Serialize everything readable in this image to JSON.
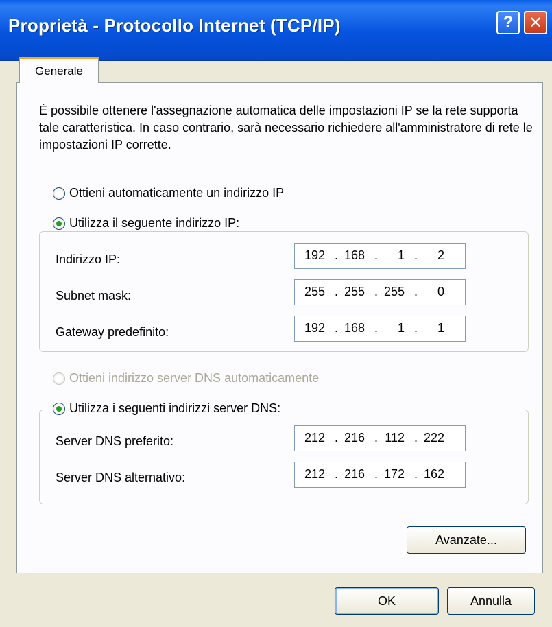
{
  "window": {
    "title": "Proprietà - Protocollo Internet (TCP/IP)",
    "help_label": "?",
    "close_label": "✕"
  },
  "tab": {
    "label": "Generale"
  },
  "description": "È possibile ottenere l'assegnazione automatica delle impostazioni IP se la rete supporta tale caratteristica. In caso contrario, sarà necessario richiedere all'amministratore di rete le impostazioni IP corrette.",
  "ip": {
    "auto_label": "Ottieni automaticamente un indirizzo IP",
    "auto_selected": false,
    "manual_label": "Utilizza il seguente indirizzo IP:",
    "manual_selected": true,
    "fields": [
      {
        "label": "Indirizzo IP:",
        "octets": [
          "192",
          "168",
          "1",
          "2"
        ]
      },
      {
        "label": "Subnet mask:",
        "octets": [
          "255",
          "255",
          "255",
          "0"
        ]
      },
      {
        "label": "Gateway predefinito:",
        "octets": [
          "192",
          "168",
          "1",
          "1"
        ]
      }
    ]
  },
  "dns": {
    "auto_label": "Ottieni indirizzo server DNS automaticamente",
    "auto_enabled": false,
    "manual_label": "Utilizza i seguenti indirizzi server DNS:",
    "manual_selected": true,
    "fields": [
      {
        "label": "Server DNS preferito:",
        "octets": [
          "212",
          "216",
          "112",
          "222"
        ]
      },
      {
        "label": "Server DNS alternativo:",
        "octets": [
          "212",
          "216",
          "172",
          "162"
        ]
      }
    ]
  },
  "buttons": {
    "advanced": "Avanzate...",
    "ok": "OK",
    "cancel": "Annulla"
  },
  "colors": {
    "titlebar": "#0553de",
    "face": "#ece9d8",
    "tab_highlight": "#f5a623",
    "radio_dot": "#21a121",
    "disabled_text": "#aca899"
  }
}
